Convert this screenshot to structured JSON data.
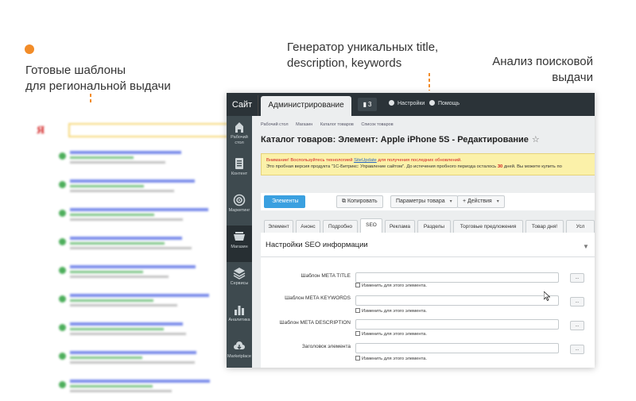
{
  "annotations": {
    "regional_line1": "Готовые шаблоны",
    "regional_line2": "для региональной выдачи",
    "generator_line1": "Генератор уникальных title,",
    "generator_line2": "description, keywords",
    "analysis_line1": "Анализ поисковой",
    "analysis_line2": "выдачи"
  },
  "colors": {
    "accent_orange": "#f28c28",
    "topbar": "#2b3338",
    "sidebar": "#3e4a4f",
    "primary_button": "#3aa0e0",
    "alert_bg": "#fbf1a9"
  },
  "topbar": {
    "site_tab": "Сайт",
    "admin_tab": "Администрирование",
    "notifications_count": "3",
    "settings": "Настройки",
    "help": "Помощь"
  },
  "sidebar": {
    "items": [
      {
        "label": "Рабочий стол",
        "icon": "desktop-icon"
      },
      {
        "label": "Контент",
        "icon": "document-icon"
      },
      {
        "label": "Маркетинг",
        "icon": "target-icon"
      },
      {
        "label": "Магазин",
        "icon": "cart-icon"
      },
      {
        "label": "Сервисы",
        "icon": "layers-icon"
      },
      {
        "label": "Аналитика",
        "icon": "bar-chart-icon"
      },
      {
        "label": "Marketplace",
        "icon": "cloud-download-icon"
      }
    ]
  },
  "breadcrumbs": [
    "Рабочий стол",
    "Магазин",
    "Каталог товаров",
    "Список товаров"
  ],
  "page_title": "Каталог товаров: Элемент: Apple iPhone 5S - Редактирование",
  "alert": {
    "warning_prefix": "Внимание! Воспользуйтесь технологией",
    "link": "SiteUpdate",
    "warning_suffix": "для получения последних обновлений.",
    "trial_text": "Это пробная версия продукта \"1С-Битрикс: Управление сайтом\". До истечения пробного периода осталось",
    "days": "30",
    "trial_suffix": "дней. Вы можете купить по"
  },
  "toolbar": {
    "elements": "Элементы",
    "copy": "Копировать",
    "params": "Параметры товара",
    "actions": "Действия"
  },
  "tabs": [
    "Элемент",
    "Анонс",
    "Подробно",
    "SEO",
    "Реклама",
    "Разделы",
    "Торговые предложения",
    "Товар дня!",
    "Усл"
  ],
  "seo": {
    "heading": "Настройки SEO информации",
    "fields": [
      {
        "label": "Шаблон META TITLE",
        "checkbox": "Изменить для этого элемента."
      },
      {
        "label": "Шаблон META KEYWORDS",
        "checkbox": "Изменить для этого элемента."
      },
      {
        "label": "Шаблон META DESCRIPTION",
        "checkbox": "Изменить для этого элемента."
      },
      {
        "label": "Заголовок элемента",
        "checkbox": "Изменить для этого элемента."
      }
    ],
    "more_button": "..."
  }
}
